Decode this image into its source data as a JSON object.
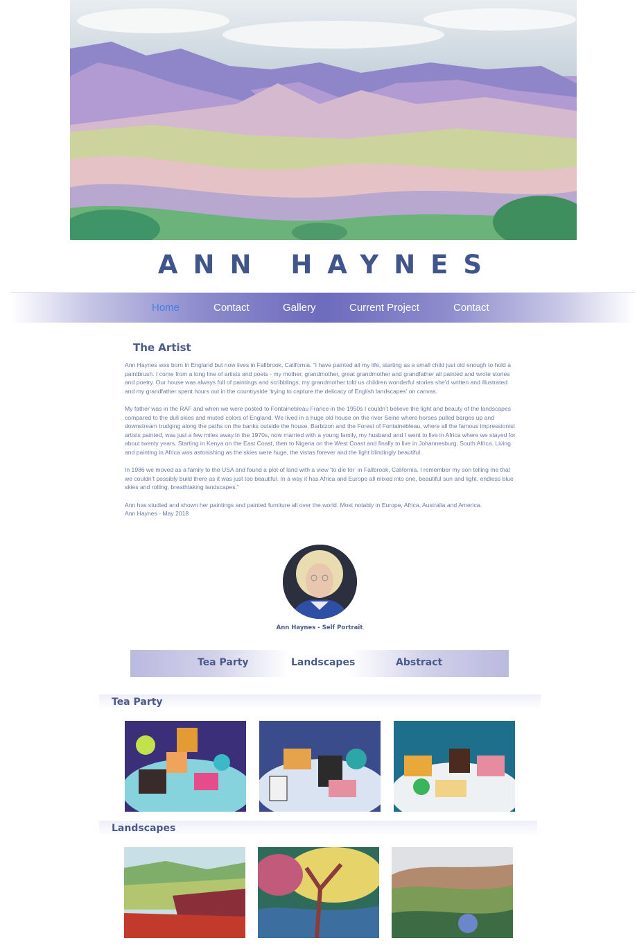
{
  "site": {
    "title": "ANN HAYNES"
  },
  "nav": {
    "items": [
      "Home",
      "Contact",
      "Gallery",
      "Current Project",
      "Contact"
    ],
    "active_index": 0
  },
  "artist": {
    "heading": "The Artist",
    "paragraphs": [
      "Ann Haynes was born in England but now lives in Fallbrook, California. “I have painted all my life, starting as a small child just old enough to hold a paintbrush. I come from a long line of artists and poets - my mother, grandmother, great grandmother and grandfather all painted and wrote stories and poetry. Our house was always full of paintings and scribblings; my grandmother told us children wonderful stories she’d written and illustrated and my grandfather spent hours out in the countryside ‘trying to capture the delicacy of English landscapes’ on canvas.",
      "My father was in the RAF and when we were posted to Fontainebleau France in the 1950s I couldn’t believe the light and beauty of the landscapes compared to the dull skies and muted colors of England. We lived in a huge old house on the river Seine where horses pulled barges up and downstream trudging along the paths on the banks outside the house. Barbizon and the Forest of Fontainebleau, where all the famous impressionist artists painted, was just a few miles away.In the 1970s, now married with a young family, my husband and I went to live in Africa where we stayed for about twenty years. Starting in Kenya on the East Coast, then to Nigeria on the West Coast and finally to live in Johannesburg, South Africa. Living and painting in Africa was astonishing as the skies were huge, the vistas forever and the light blindingly beautiful.",
      "In 1986 we moved as a family to the USA and found a plot of land with a view ‘to die for’ in Fallbrook, California. I remember my son telling me that we couldn’t possibly build there as it was just too beautiful. In a way it has Africa and Europe all mixed into one, beautiful sun and light, endless blue skies and rolling, breathtaking landscapes.”",
      "Ann has studied and shown her paintings and painted furniture all over the world. Most notably in Europe, Africa, Australia and America.\nAnn Haynes - May 2018"
    ],
    "portrait_caption": "Ann Haynes - Self Portrait"
  },
  "gallery_tabs": [
    "Tea Party",
    "Landscapes",
    "Abstract"
  ],
  "categories": [
    {
      "title": "Tea Party"
    },
    {
      "title": "Landscapes"
    }
  ],
  "colors": {
    "title": "#41558d",
    "nav_active": "#3f7fe6",
    "nav_band": "#6d6bbc",
    "body_text": "#6a7aa6"
  }
}
